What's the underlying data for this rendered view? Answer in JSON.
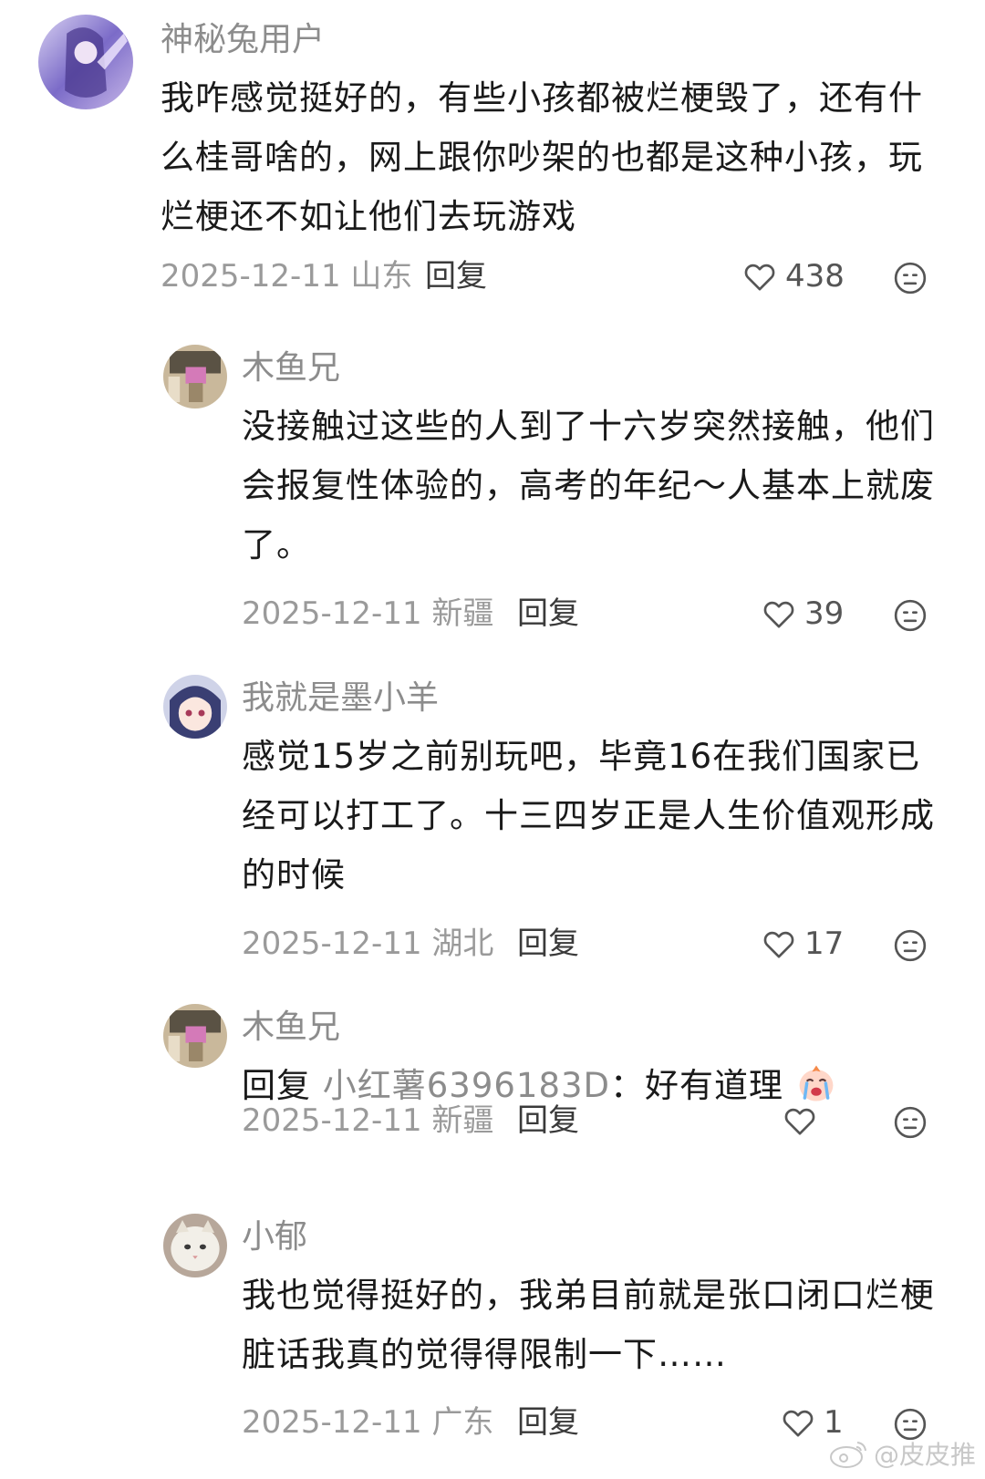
{
  "comments": [
    {
      "username": "神秘兔用户",
      "content": "我咋感觉挺好的，有些小孩都被烂梗毁了，还有什么桂哥啥的，网上跟你吵架的也都是这种小孩，玩烂梗还不如让他们去玩游戏",
      "date_location": "2025-12-11 山东",
      "reply_label": "回复",
      "likes": "438"
    },
    {
      "username": "木鱼兄",
      "content": "没接触过这些的人到了十六岁突然接触，他们会报复性体验的，高考的年纪～人基本上就废了。",
      "date_location": "2025-12-11 新疆",
      "reply_label": "回复",
      "likes": "39"
    },
    {
      "username": "我就是墨小羊",
      "content": "感觉15岁之前别玩吧，毕竟16在我们国家已经可以打工了。十三四岁正是人生价值观形成的时候",
      "date_location": "2025-12-11 湖北",
      "reply_label": "回复",
      "likes": "17"
    },
    {
      "username": "木鱼兄",
      "reply_prefix": "回复",
      "reply_target": "小红薯6396183D",
      "content": "：好有道理",
      "date_location": "2025-12-11 新疆",
      "reply_label": "回复",
      "likes": ""
    },
    {
      "username": "小郁",
      "content": "我也觉得挺好的，我弟目前就是张口闭口烂梗脏话我真的觉得得限制一下……",
      "date_location": "2025-12-11 广东",
      "reply_label": "回复",
      "likes": "1"
    }
  ],
  "watermark": "@皮皮推",
  "icons": {
    "like": "heart-outline-icon",
    "dislike": "neutral-face-icon",
    "emoji": "crying-face-emoji",
    "watermark": "weibo-logo-icon"
  }
}
